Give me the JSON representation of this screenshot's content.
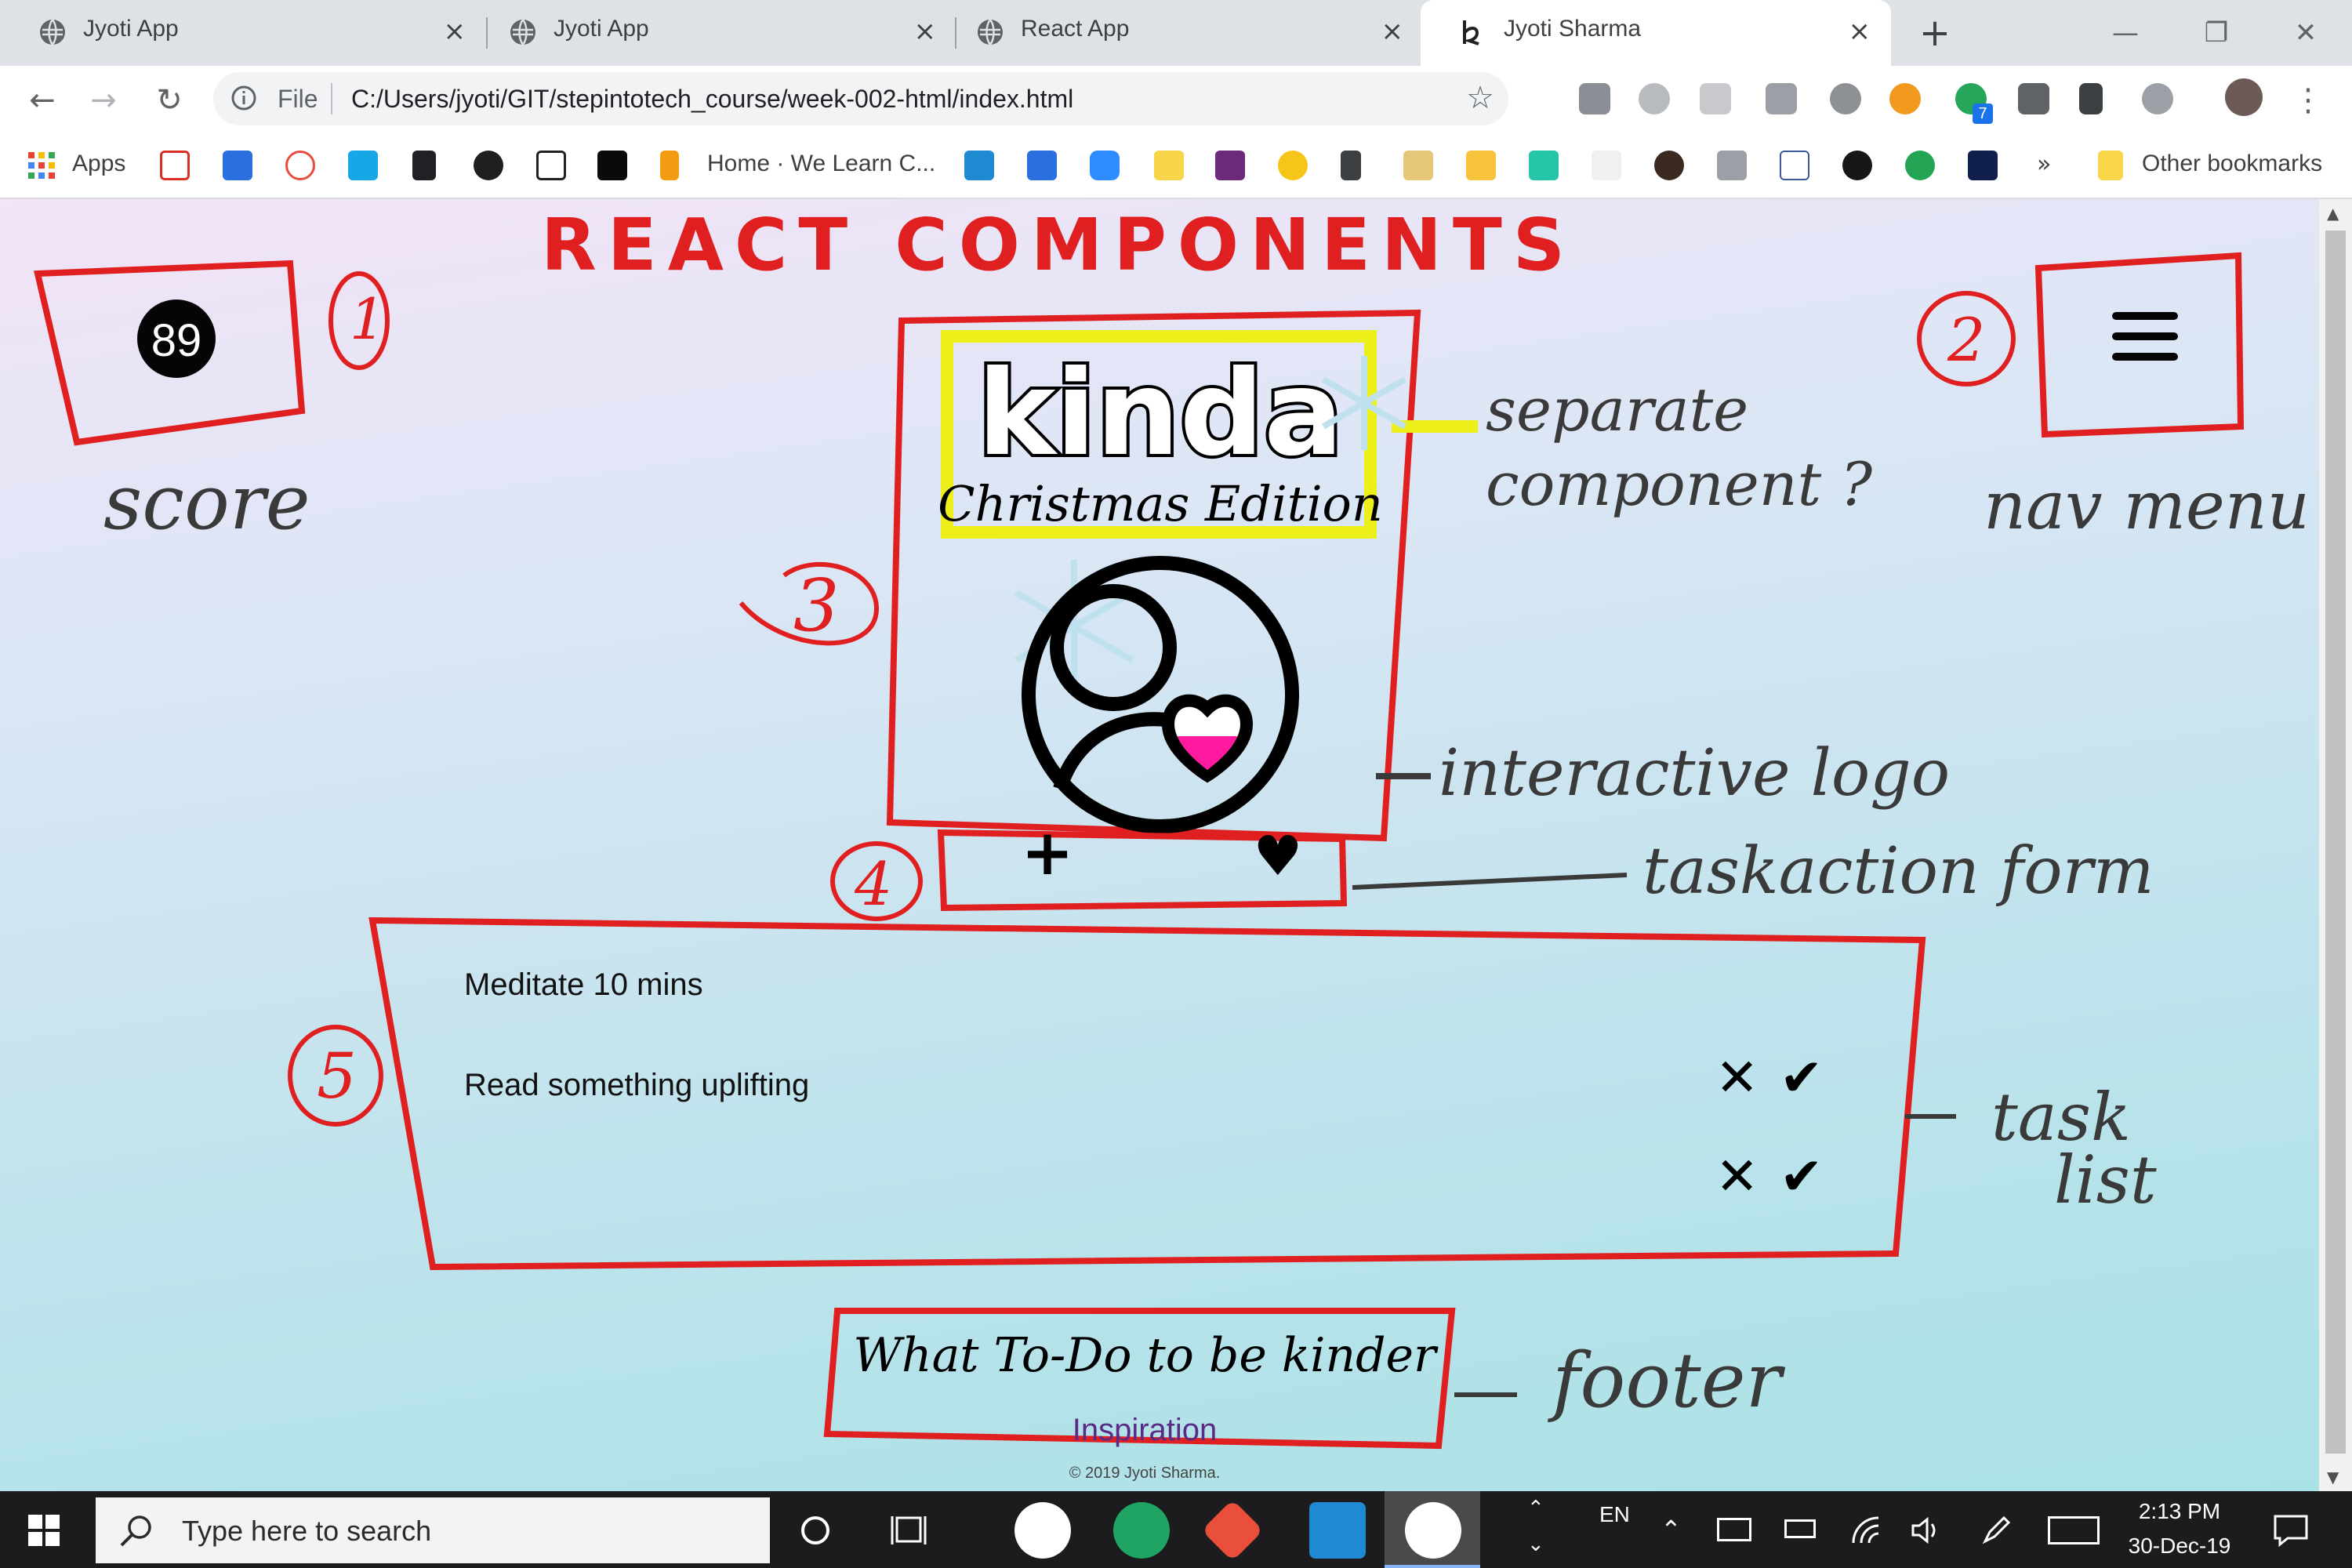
{
  "browser": {
    "tabs": [
      {
        "title": "Jyoti App",
        "close": "×"
      },
      {
        "title": "Jyoti App",
        "close": "×"
      },
      {
        "title": "React App",
        "close": "×"
      },
      {
        "title": "Jyoti Sharma",
        "close": "×"
      }
    ],
    "new_tab": "+",
    "window_controls": {
      "minimize": "—",
      "restore": "❐",
      "close": "✕"
    },
    "nav": {
      "back": "←",
      "forward": "→",
      "reload": "↻"
    },
    "address": {
      "scheme_label": "File",
      "url": "C:/Users/jyoti/GIT/stepintotech_course/week-002-html/index.html",
      "star": "☆"
    },
    "extension_badge": "7",
    "menu": "⋮",
    "bookmarks": [
      {
        "label": "Apps"
      },
      {
        "label": "Home · We Learn C..."
      }
    ],
    "bookmarks_overflow": "»",
    "other_bookmarks": "Other bookmarks"
  },
  "page": {
    "score": "89",
    "logo_title": "kinda",
    "logo_subtitle": "Christmas Edition",
    "task_add": "+",
    "task_like": "♥",
    "tasks": [
      {
        "text": "Meditate 10 mins"
      },
      {
        "text": "Read something uplifting"
      }
    ],
    "task_reject": "✕",
    "task_accept": "✔",
    "footer_title": "What To-Do to be kinder",
    "footer_link": "Inspiration",
    "footer_copyright": "© 2019 Jyoti Sharma."
  },
  "annotations": {
    "heading": "REACT COMPONENTS",
    "n1": "1",
    "n2": "2",
    "n3": "3",
    "n4": "4",
    "n5": "5",
    "score": "score",
    "nav_menu": "nav menu",
    "separate_component": "separate component ?",
    "interactive_logo": "interactive logo",
    "taskaction_form": "taskaction form",
    "task_list": "task list",
    "footer": "footer"
  },
  "taskbar": {
    "search_placeholder": "Type here to search",
    "language": "EN",
    "time": "2:13 PM",
    "date": "30-Dec-19"
  },
  "colors": {
    "annotation_red": "#e02020",
    "highlight_yellow": "#ecef1a",
    "heart_pink": "#ff1aa0",
    "link_purple": "#5b2a86"
  }
}
